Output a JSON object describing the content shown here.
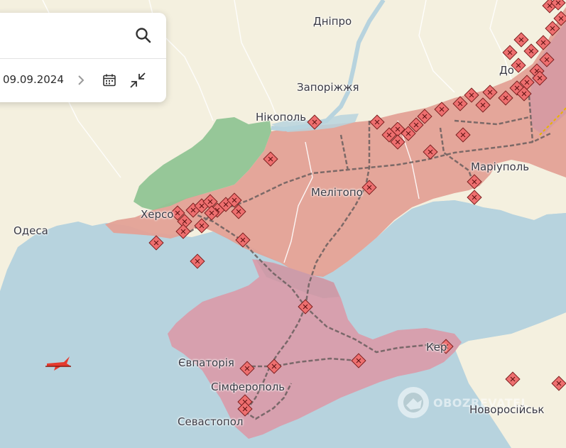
{
  "search": {
    "icon": "search-icon"
  },
  "date_bar": {
    "date": "09.09.2024",
    "next_icon": "chevron-right-icon",
    "calendar_icon": "calendar-icon",
    "collapse_icon": "collapse-arrows-icon"
  },
  "places": {
    "dnipro": "Дніпро",
    "zaporizhzhia": "Запоріжжя",
    "nikopol": "Нікополь",
    "mariupol": "Маріуполь",
    "melitopol": "Мелітопо",
    "kherson": "Херсо",
    "odesa": "Одеса",
    "yevpatoria": "Євпаторія",
    "simferopol": "Сімферополь",
    "sevastopol": "Севастопол",
    "kerch": "Кер",
    "novorossiysk": "Новоросійськ",
    "donetsk": "До"
  },
  "watermark": {
    "text": "OBOZREVATEL"
  },
  "colors": {
    "sea": "#b7d3de",
    "land": "#f4f0df",
    "occupied": "#e3a196",
    "crimea": "#d7a0ae",
    "liberated": "#90c494",
    "marker": "#ee6f6f",
    "rail": "#7a6a6a"
  }
}
